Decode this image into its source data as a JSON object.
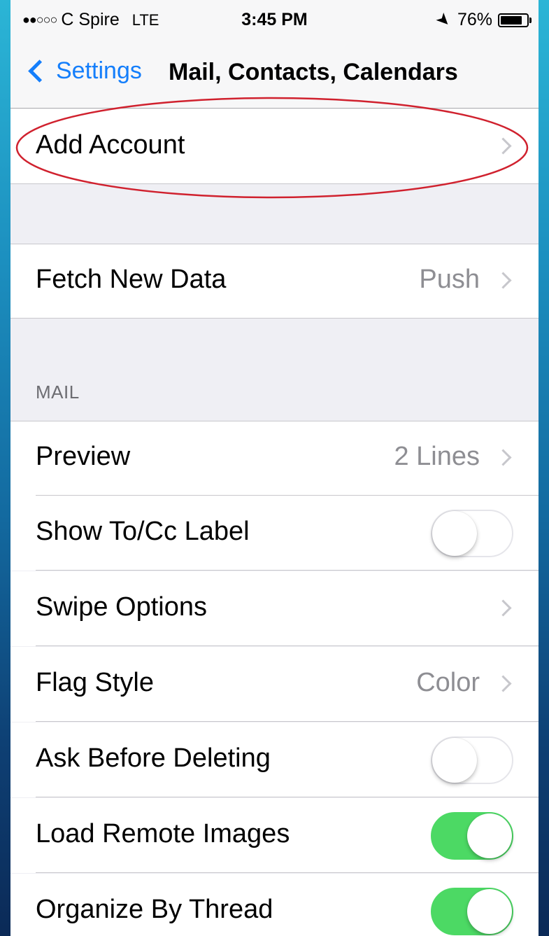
{
  "status_bar": {
    "signal": "●●○○○",
    "carrier": "C Spire",
    "network": "LTE",
    "time": "3:45 PM",
    "battery_percent": "76%",
    "battery_level": 0.76,
    "location_icon": "location-arrow-icon",
    "battery_icon": "battery-icon"
  },
  "nav": {
    "back_label": "Settings",
    "title": "Mail, Contacts, Calendars"
  },
  "accounts": {
    "add_account_label": "Add Account"
  },
  "fetch": {
    "label": "Fetch New Data",
    "value": "Push"
  },
  "mail_section": {
    "header": "MAIL",
    "rows": [
      {
        "label": "Preview",
        "value": "2 Lines",
        "type": "disclosure"
      },
      {
        "label": "Show To/Cc Label",
        "type": "toggle",
        "on": false
      },
      {
        "label": "Swipe Options",
        "value": "",
        "type": "disclosure"
      },
      {
        "label": "Flag Style",
        "value": "Color",
        "type": "disclosure"
      },
      {
        "label": "Ask Before Deleting",
        "type": "toggle",
        "on": false
      },
      {
        "label": "Load Remote Images",
        "type": "toggle",
        "on": true
      },
      {
        "label": "Organize By Thread",
        "type": "toggle",
        "on": true
      }
    ]
  },
  "colors": {
    "accent": "#147efb",
    "toggle_on": "#4cd964",
    "annotation": "#d0212e"
  }
}
